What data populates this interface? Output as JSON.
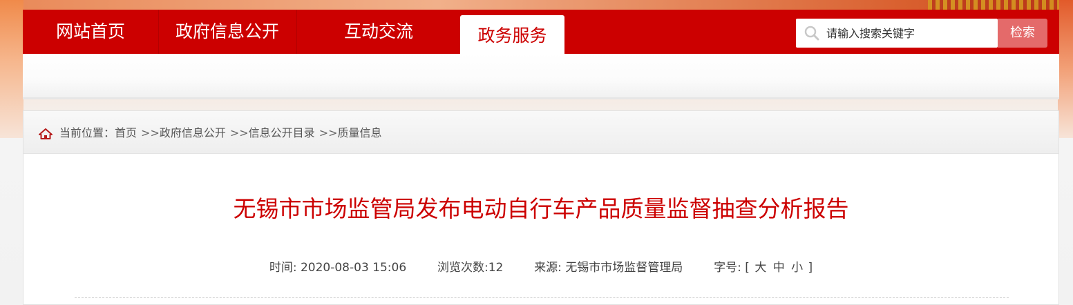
{
  "nav": {
    "items": [
      "网站首页",
      "政府信息公开",
      "互动交流"
    ],
    "active": "政务服务"
  },
  "search": {
    "placeholder": "请输入搜索关键字",
    "button": "检索"
  },
  "breadcrumb": {
    "prefix": "当前位置：",
    "items": [
      "首页",
      "政府信息公开",
      "信息公开目录",
      "质量信息"
    ],
    "separator": ">>"
  },
  "article": {
    "title": "无锡市市场监管局发布电动自行车产品质量监督抽查分析报告",
    "time_label": "时间:",
    "time": "2020-08-03 15:06",
    "views_label": "浏览次数:",
    "views": "12",
    "source_label": "来源:",
    "source": "无锡市市场监督管理局",
    "font_size_label": "字号:",
    "font_size_open": "[",
    "font_sizes": [
      "大",
      "中",
      "小"
    ],
    "font_size_close": "]"
  },
  "colors": {
    "brand_red": "#cc0000",
    "search_button": "#e46a6a"
  }
}
